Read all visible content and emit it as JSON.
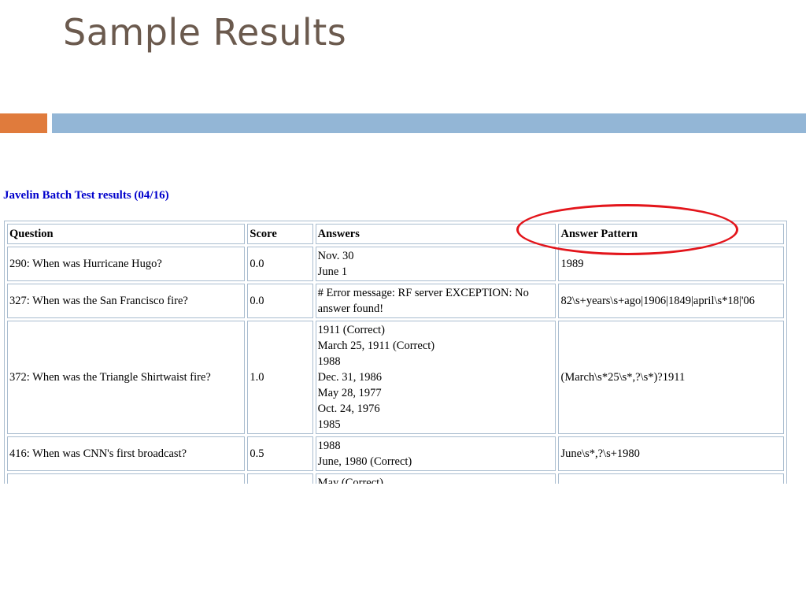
{
  "slide": {
    "title": "Sample Results",
    "colors": {
      "title": "#6b5a4e",
      "accent_orange": "#e07b3c",
      "accent_blue": "#93b6d6",
      "highlight": "#e3151b",
      "link_blue": "#0000cc"
    }
  },
  "screenshot": {
    "heading": "Javelin Batch Test results (04/16)",
    "columns": [
      "Question",
      "Score",
      "Answers",
      "Answer Pattern"
    ],
    "rows": [
      {
        "question": "290: When was Hurricane Hugo?",
        "score": "0.0",
        "answers": [
          "Nov. 30",
          "June 1"
        ],
        "pattern": "1989"
      },
      {
        "question": "327: When was the San Francisco fire?",
        "score": "0.0",
        "answers": [
          "# Error message: RF server EXCEPTION: No answer found!"
        ],
        "pattern": "82\\s+years\\s+ago|1906|1849|april\\s*18|'06"
      },
      {
        "question": "372: When was the Triangle Shirtwaist fire?",
        "score": "1.0",
        "answers": [
          "1911 (Correct)",
          "March 25, 1911 (Correct)",
          "1988",
          "Dec. 31, 1986",
          "May 28, 1977",
          "Oct. 24, 1976",
          "1985"
        ],
        "pattern": "(March\\s*25\\s*,?\\s*)?1911"
      },
      {
        "question": "416: When was CNN's first broadcast?",
        "score": "0.5",
        "answers": [
          "1988",
          "June, 1980 (Correct)"
        ],
        "pattern": "June\\s*,?\\s+1980"
      },
      {
        "question": "",
        "score": "",
        "answers": [
          "May (Correct)"
        ],
        "pattern": ""
      }
    ]
  }
}
